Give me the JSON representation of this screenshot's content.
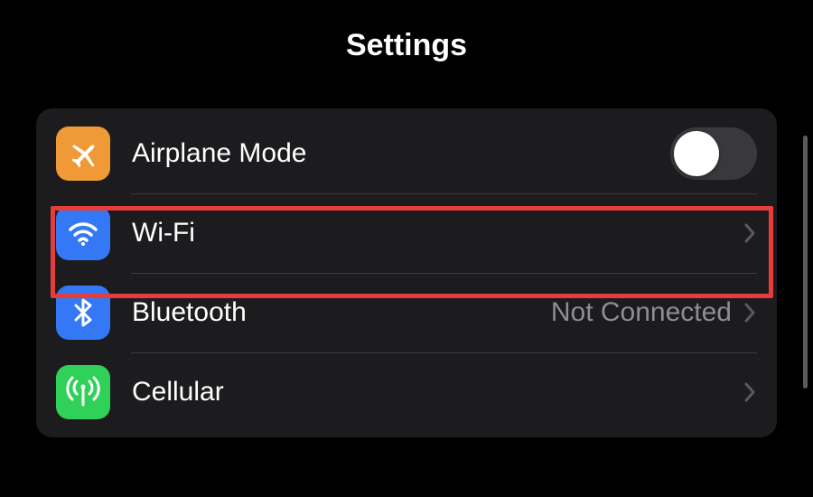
{
  "header": {
    "title": "Settings"
  },
  "rows": {
    "airplane": {
      "label": "Airplane Mode",
      "toggle_on": false,
      "icon_color": "#f09a37"
    },
    "wifi": {
      "label": "Wi-Fi",
      "value": "",
      "icon_color": "#3478f6",
      "highlighted": true
    },
    "bluetooth": {
      "label": "Bluetooth",
      "value": "Not Connected",
      "icon_color": "#3478f6"
    },
    "cellular": {
      "label": "Cellular",
      "value": "",
      "icon_color": "#30d158"
    }
  },
  "highlight": {
    "color": "#e73c3c"
  }
}
